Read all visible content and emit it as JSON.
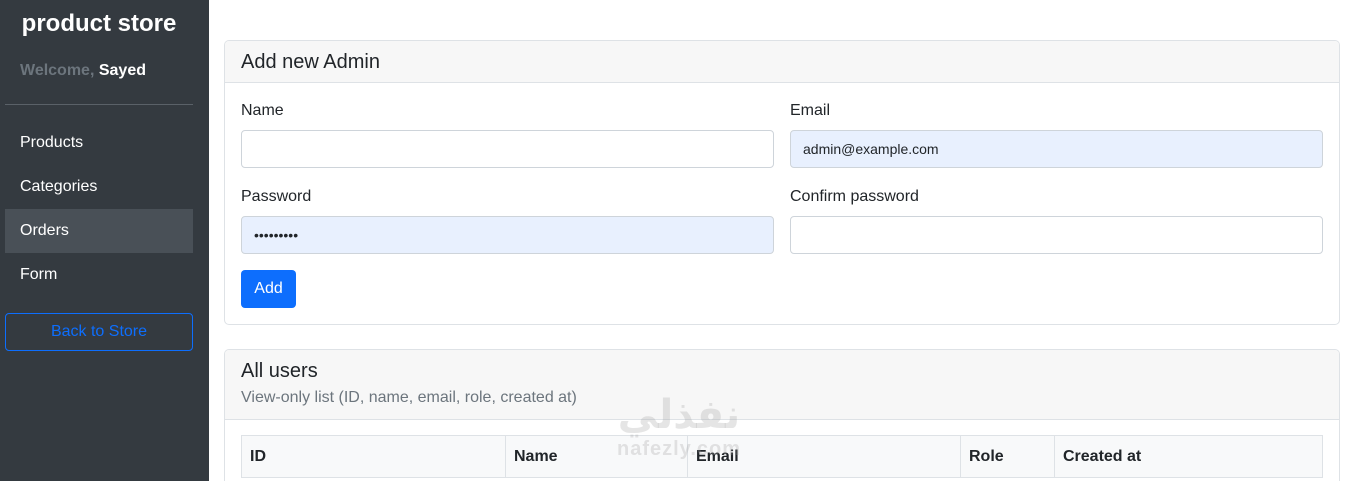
{
  "sidebar": {
    "brand": "product store",
    "welcome_prefix": "Welcome,",
    "welcome_user": "Sayed",
    "items": [
      {
        "label": "Products",
        "active": false
      },
      {
        "label": "Categories",
        "active": false
      },
      {
        "label": "Orders",
        "active": true
      },
      {
        "label": "Form",
        "active": false
      }
    ],
    "back_button": "Back to Store"
  },
  "add_admin": {
    "title": "Add new Admin",
    "name_label": "Name",
    "name_value": "",
    "email_label": "Email",
    "email_value": "admin@example.com",
    "password_label": "Password",
    "password_value": "•••••••••",
    "confirm_label": "Confirm password",
    "confirm_value": "",
    "add_button": "Add"
  },
  "users": {
    "title": "All users",
    "subtitle": "View-only list (ID, name, email, role, created at)",
    "columns": [
      "ID",
      "Name",
      "Email",
      "Role",
      "Created at"
    ]
  },
  "watermark": {
    "logo": "نفذلي",
    "text": "nafezly.com"
  },
  "colors": {
    "sidebar_bg": "#343a40",
    "active_item_bg": "#495057",
    "primary": "#0d6efd",
    "autofill_bg": "#e8f0fe"
  }
}
